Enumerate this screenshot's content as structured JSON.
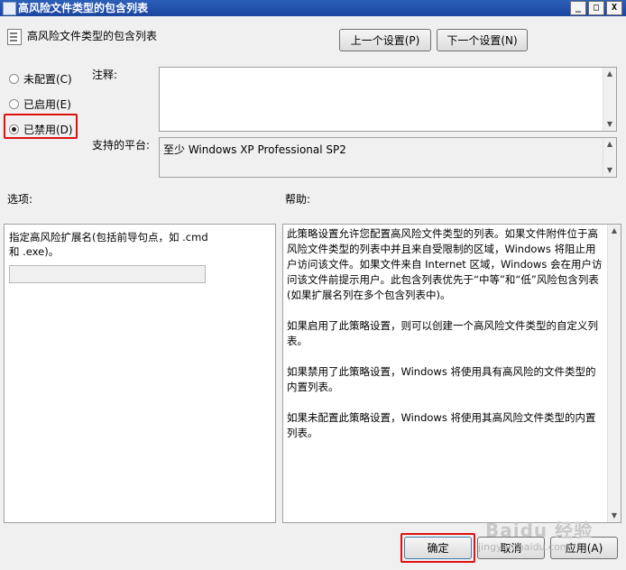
{
  "window": {
    "title": "高风险文件类型的包含列表",
    "buttons": [
      "_",
      "□",
      "X"
    ]
  },
  "header": {
    "title": "高风险文件类型的包含列表",
    "prev_label": "上一个设置(P)",
    "next_label": "下一个设置(N)"
  },
  "state": {
    "options": [
      {
        "label": "未配置(C)",
        "checked": false
      },
      {
        "label": "已启用(E)",
        "checked": false
      },
      {
        "label": "已禁用(D)",
        "checked": true
      }
    ]
  },
  "comment": {
    "label": "注释:",
    "value": ""
  },
  "platform": {
    "label": "支持的平台:",
    "value": "至少 Windows XP Professional SP2"
  },
  "options_panel": {
    "label": "选项:",
    "text_line1": "指定高风险扩展名(包括前导句点，如 .cmd",
    "text_line2": "和 .exe)。",
    "input_value": ""
  },
  "help_panel": {
    "label": "帮助:",
    "paragraphs": [
      "此策略设置允许您配置高风险文件类型的列表。如果文件附件位于高风险文件类型的列表中并且来自受限制的区域，Windows 将阻止用户访问该文件。如果文件来自 Internet 区域，Windows 会在用户访问该文件前提示用户。此包含列表优先于“中等”和“低”风险包含列表(如果扩展名列在多个包含列表中)。",
      "如果启用了此策略设置，则可以创建一个高风险文件类型的自定义列表。",
      "如果禁用了此策略设置，Windows 将使用具有高风险的文件类型的内置列表。",
      "如果未配置此策略设置，Windows 将使用其高风险文件类型的内置列表。"
    ]
  },
  "footer": {
    "ok_label": "确定",
    "cancel_label": "取消",
    "apply_label": "应用(A)"
  },
  "watermark": {
    "text": "Baidu 经验",
    "url": "jingyan.baidu.com"
  },
  "colors": {
    "highlight_box": "#e01010",
    "title_bar": "#1c46a0"
  }
}
